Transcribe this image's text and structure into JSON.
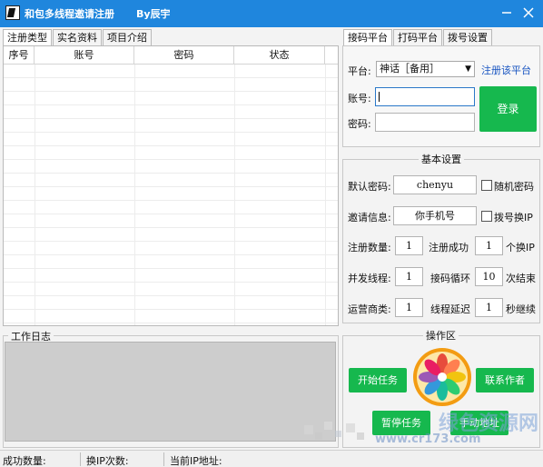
{
  "window": {
    "title": "和包多线程邀请注册",
    "author": "By辰宇",
    "minimize_icon": "minimize-icon",
    "close_icon": "close-icon"
  },
  "left_tabs": [
    "注册类型",
    "实名资料",
    "项目介绍"
  ],
  "table": {
    "columns": [
      "序号",
      "账号",
      "密码",
      "状态"
    ],
    "rows": []
  },
  "log": {
    "title": "工作日志"
  },
  "right_tabs": [
    "接码平台",
    "打码平台",
    "拨号设置"
  ],
  "platform": {
    "label": "平台:",
    "selected": "神话［备用］",
    "register_link": "注册该平台",
    "account_label": "账号:",
    "account_value": "",
    "password_label": "密码:",
    "password_value": "",
    "login_button": "登录"
  },
  "basic_settings": {
    "title": "基本设置",
    "default_password_label": "默认密码:",
    "default_password": "chenyu",
    "random_password_label": "随机密码",
    "random_password_checked": false,
    "invite_label": "邀请信息:",
    "invite_value": "你手机号",
    "dial_switch_label": "拨号换IP",
    "dial_switch_checked": false,
    "reg_count_label": "注册数量:",
    "reg_count": "1",
    "reg_success_label": "注册成功",
    "reg_success": "1",
    "per_ip_label": "个换IP",
    "threads_label": "并发线程:",
    "threads": "1",
    "code_loop_label": "接码循环",
    "code_loop": "10",
    "loop_end_label": "次结束",
    "carrier_label": "运营商类:",
    "carrier": "1",
    "thread_delay_label": "线程延迟",
    "thread_delay": "1",
    "delay_unit_label": "秒继续"
  },
  "operations": {
    "title": "操作区",
    "start_button": "开始任务",
    "contact_button": "联系作者",
    "stop_button": "暂停任务",
    "manual_button": "手动地址"
  },
  "statusbar": {
    "success_label": "成功数量:",
    "ip_change_label": "换IP次数:",
    "current_ip_label": "当前IP地址:"
  },
  "watermark": {
    "text": "绿色资源网",
    "url": "www.cr173.com"
  },
  "colors": {
    "titlebar": "#1f86dd",
    "green_button": "#16b84e",
    "link": "#1a56c2"
  }
}
